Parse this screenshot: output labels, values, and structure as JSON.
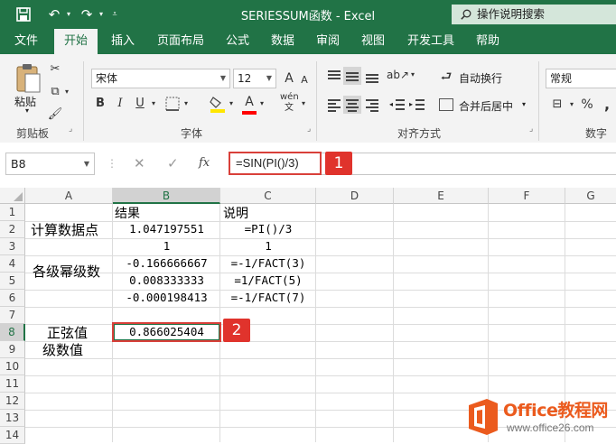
{
  "window": {
    "title": "SERIESSUM函数 - Excel",
    "search_placeholder": "操作说明搜索"
  },
  "tabs": [
    "文件",
    "开始",
    "插入",
    "页面布局",
    "公式",
    "数据",
    "审阅",
    "视图",
    "开发工具",
    "帮助"
  ],
  "active_tab": "开始",
  "ribbon": {
    "paste_label": "粘贴",
    "clipboard_group": "剪贴板",
    "font_name": "宋体",
    "font_size": "12",
    "font_group": "字体",
    "bold": "B",
    "italic": "I",
    "underline": "U",
    "increase_font": "A",
    "decrease_font": "A",
    "wrap_text": "自动换行",
    "merge_center": "合并后居中",
    "align_group": "对齐方式",
    "number_format": "常规",
    "number_group": "数字",
    "percent": "%"
  },
  "formula_bar": {
    "name_box": "B8",
    "fx_label": "fx",
    "formula": "=SIN(PI()/3)"
  },
  "callouts": [
    "1",
    "2"
  ],
  "columns": [
    "A",
    "B",
    "C",
    "D",
    "E",
    "F",
    "G"
  ],
  "rows": [
    "1",
    "2",
    "3",
    "4",
    "5",
    "6",
    "7",
    "8",
    "9",
    "10",
    "11",
    "12",
    "13",
    "14"
  ],
  "cells": {
    "B1": "结果",
    "C1": "说明",
    "A2": "计算数据点",
    "B2": "1.047197551",
    "C2": "=PI()/3",
    "B3": "1",
    "C3": "1",
    "A4": "各级幂级数",
    "B4": "-0.166666667",
    "C4": "=-1/FACT(3)",
    "B5": "0.008333333",
    "C5": "=1/FACT(5)",
    "B6": "-0.000198413",
    "C6": "=-1/FACT(7)",
    "A8": "正弦值",
    "A9": "级数值",
    "B8": "0.866025404"
  },
  "watermark": {
    "brand": "Office教程网",
    "url": "www.office26.com"
  },
  "colors": {
    "excel_green": "#217346",
    "callout_red": "#e0332c",
    "highlight_box": "#d9403a",
    "logo_orange": "#eb5b1e"
  }
}
